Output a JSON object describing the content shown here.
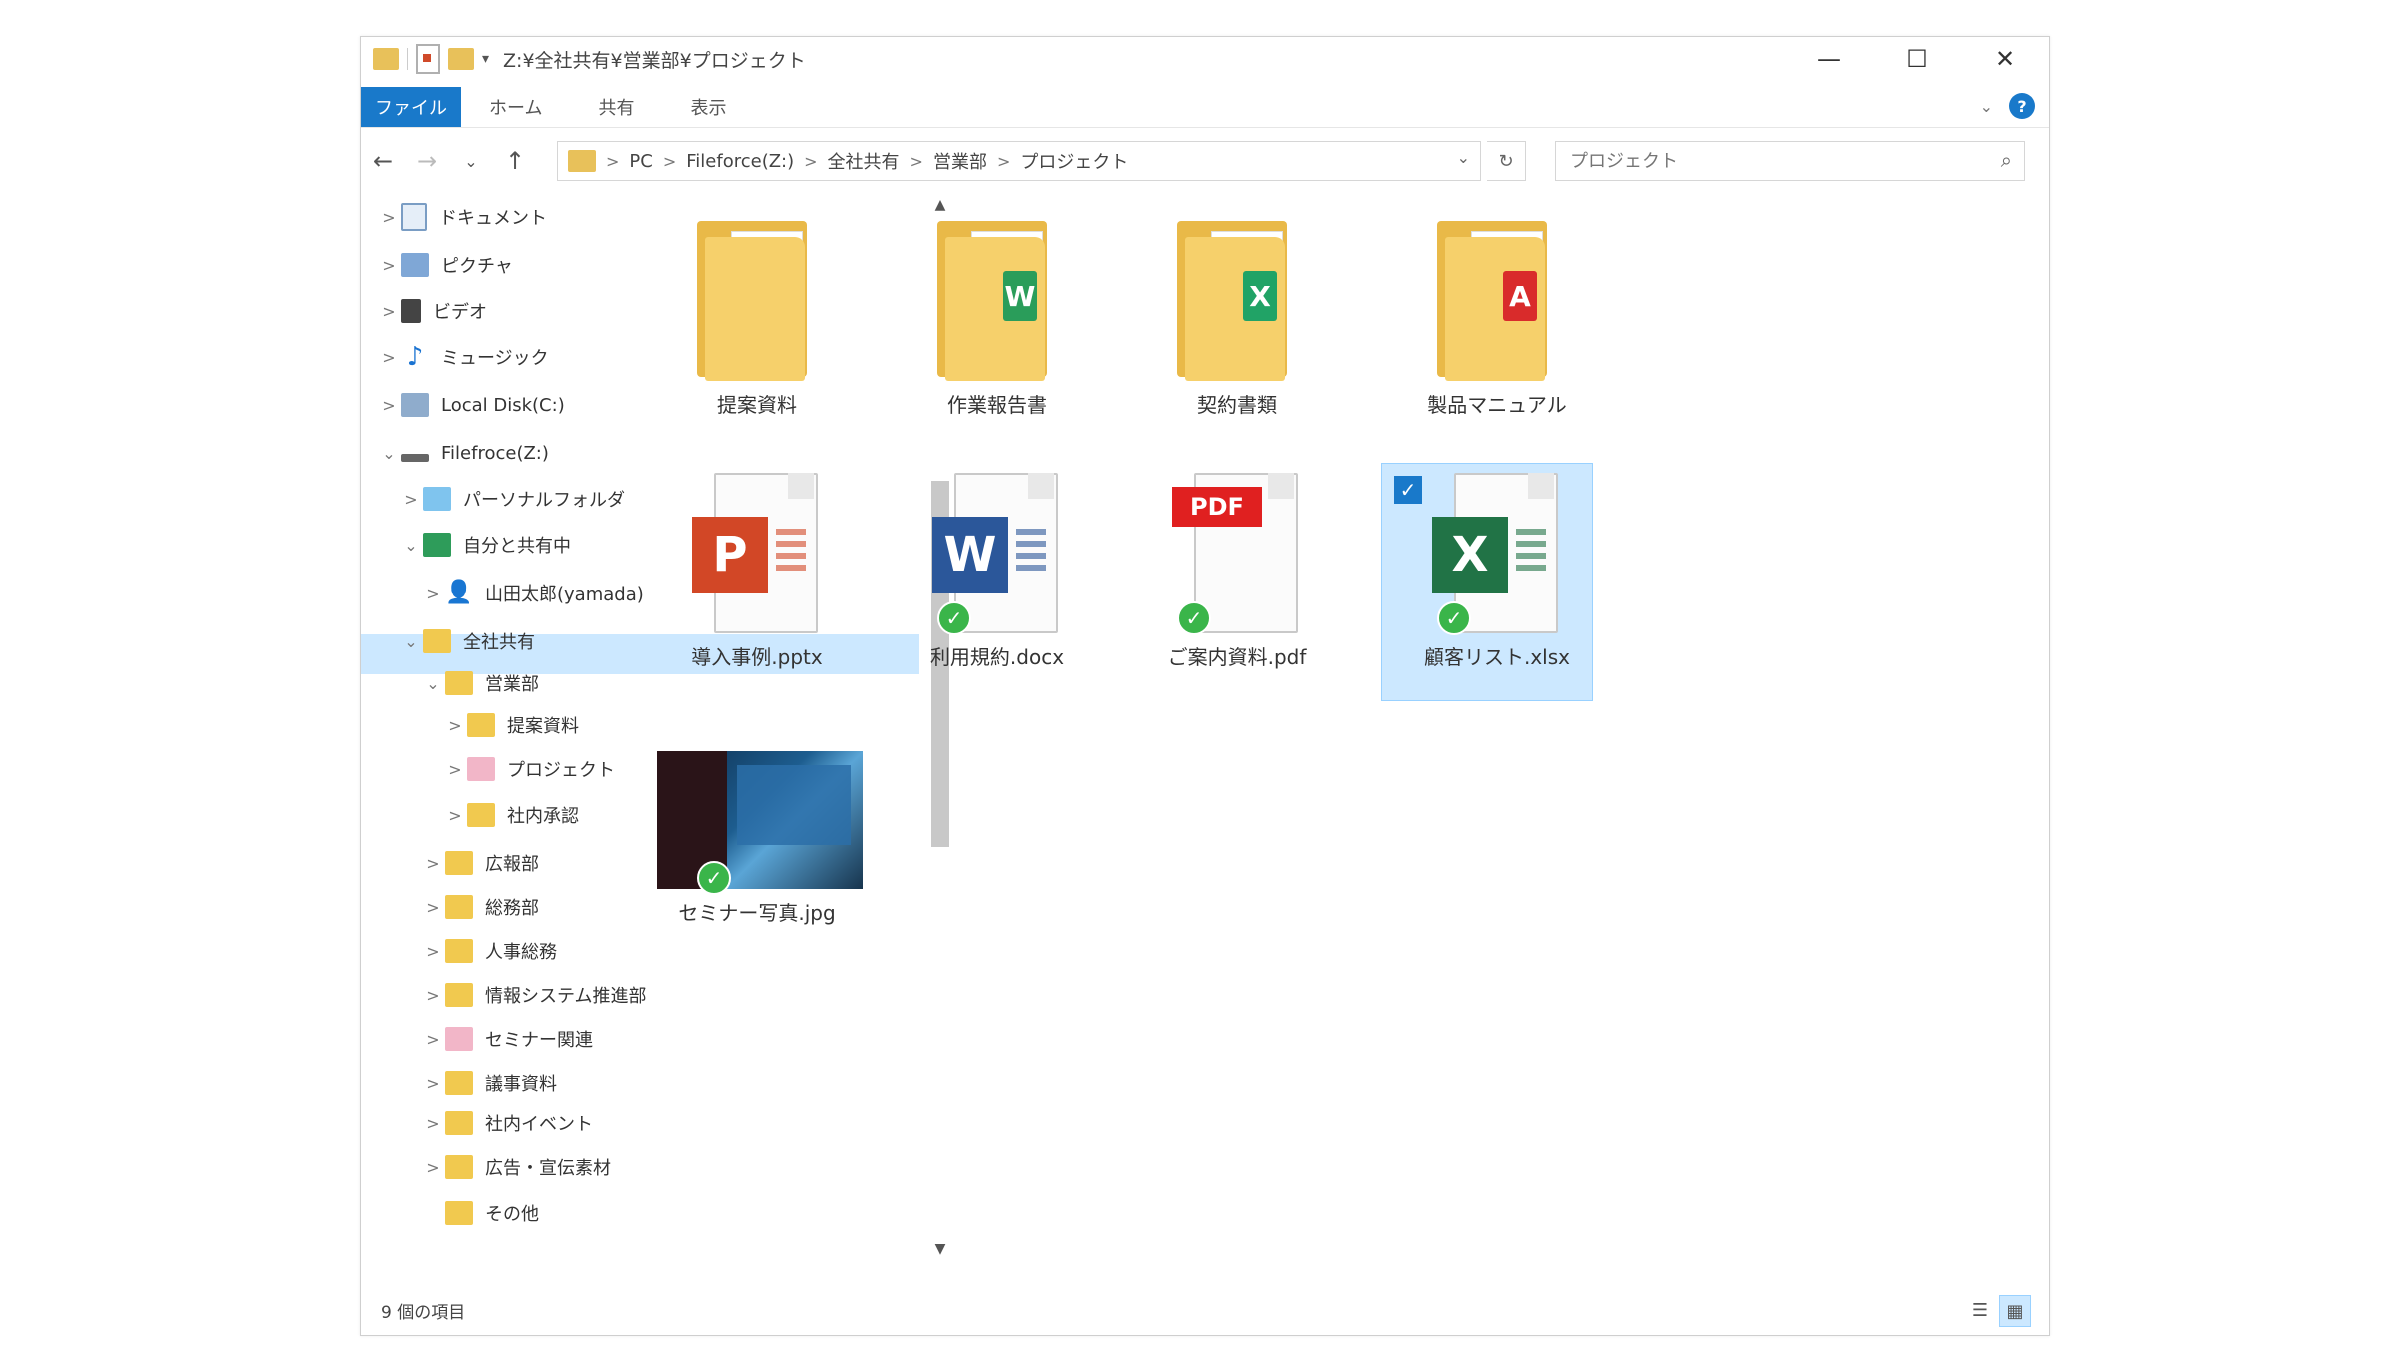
{
  "window": {
    "title": "Z:¥全社共有¥営業部¥プロジェクト",
    "controls": {
      "minimize": "—",
      "maximize": "☐",
      "close": "✕"
    }
  },
  "ribbon": {
    "tabs": [
      {
        "label": "ファイル",
        "active": true
      },
      {
        "label": "ホーム"
      },
      {
        "label": "共有"
      },
      {
        "label": "表示"
      }
    ],
    "help": "?"
  },
  "navigation": {
    "back": "←",
    "forward": "→",
    "recent": "⌄",
    "up": "↑"
  },
  "address": {
    "crumbs": [
      "PC",
      "Fileforce(Z:)",
      "全社共有",
      "営業部",
      "プロジェクト"
    ],
    "separator": ">",
    "dropdown": "⌄",
    "refresh": "↻"
  },
  "search": {
    "placeholder": "プロジェクト",
    "icon": "🔍"
  },
  "tree": [
    {
      "label": "ドキュメント",
      "icon": "document-icon",
      "indent": 0,
      "expander": ">"
    },
    {
      "label": "ピクチャ",
      "icon": "pictures-icon",
      "indent": 0,
      "expander": ">"
    },
    {
      "label": "ビデオ",
      "icon": "video-icon",
      "indent": 0,
      "expander": ">"
    },
    {
      "label": "ミュージック",
      "icon": "music-icon",
      "indent": 0,
      "expander": ">"
    },
    {
      "label": "Local Disk(C:)",
      "icon": "disk-icon",
      "indent": 0,
      "expander": ">"
    },
    {
      "label": "Filefroce(Z:)",
      "icon": "drive-icon",
      "indent": 0,
      "expander": "⌄"
    },
    {
      "label": "パーソナルフォルダ",
      "icon": "personal-folder-icon",
      "indent": 1,
      "expander": ">"
    },
    {
      "label": "自分と共有中",
      "icon": "share-icon",
      "indent": 1,
      "expander": "⌄"
    },
    {
      "label": "山田太郎(yamada)",
      "icon": "user-icon",
      "indent": 2,
      "expander": ">"
    },
    {
      "label": "全社共有",
      "icon": "folder-icon",
      "indent": 1,
      "expander": "⌄"
    },
    {
      "label": "営業部",
      "icon": "folder-icon",
      "indent": 2,
      "expander": "⌄"
    },
    {
      "label": "提案資料",
      "icon": "folder-icon",
      "indent": 3,
      "expander": ">"
    },
    {
      "label": "プロジェクト",
      "icon": "pink-folder-icon",
      "indent": 3,
      "expander": ">",
      "selected": true
    },
    {
      "label": "社内承認",
      "icon": "folder-icon",
      "indent": 3,
      "expander": ">"
    },
    {
      "label": "広報部",
      "icon": "folder-icon",
      "indent": 2,
      "expander": ">"
    },
    {
      "label": "総務部",
      "icon": "folder-icon",
      "indent": 2,
      "expander": ">"
    },
    {
      "label": "人事総務",
      "icon": "folder-icon",
      "indent": 2,
      "expander": ">"
    },
    {
      "label": "情報システム推進部",
      "icon": "folder-icon",
      "indent": 2,
      "expander": ">"
    },
    {
      "label": "セミナー関連",
      "icon": "pink-folder-icon",
      "indent": 2,
      "expander": ">"
    },
    {
      "label": "議事資料",
      "icon": "folder-icon",
      "indent": 2,
      "expander": ">"
    },
    {
      "label": "社内イベント",
      "icon": "folder-icon",
      "indent": 2,
      "expander": ">"
    },
    {
      "label": "広告・宣伝素材",
      "icon": "folder-icon",
      "indent": 2,
      "expander": ">"
    },
    {
      "label": "その他",
      "icon": "folder-icon",
      "indent": 2,
      "expander": ""
    }
  ],
  "files": [
    {
      "name": "提案資料",
      "kind": "folder",
      "badge": "",
      "badge_color": "#4a90d9"
    },
    {
      "name": "作業報告書",
      "kind": "folder",
      "badge": "W",
      "badge_color": "#2a9d5a"
    },
    {
      "name": "契約書類",
      "kind": "folder",
      "badge": "X",
      "badge_color": "#21a366"
    },
    {
      "name": "製品マニュアル",
      "kind": "folder",
      "badge": "A",
      "badge_color": "#d92b2b"
    },
    {
      "name": "導入事例.pptx",
      "kind": "pptx",
      "letter": "P",
      "color": "#d24726",
      "synced": false
    },
    {
      "name": "利用規約.docx",
      "kind": "docx",
      "letter": "W",
      "color": "#2b579a",
      "synced": true
    },
    {
      "name": "ご案内資料.pdf",
      "kind": "pdf",
      "letter": "PDF",
      "color": "#e02020",
      "synced": true
    },
    {
      "name": "顧客リスト.xlsx",
      "kind": "xlsx",
      "letter": "X",
      "color": "#217346",
      "synced": true,
      "selected": true
    },
    {
      "name": "セミナー写真.jpg",
      "kind": "jpg",
      "synced": true
    }
  ],
  "status": {
    "count": "9 個の項目"
  },
  "view": {
    "details": "☰",
    "large_icons": "▦"
  },
  "colors": {
    "accent": "#1979ca",
    "selection": "#cce8ff",
    "sync_ok": "#3ab54a",
    "folder": "#f6d06b"
  }
}
